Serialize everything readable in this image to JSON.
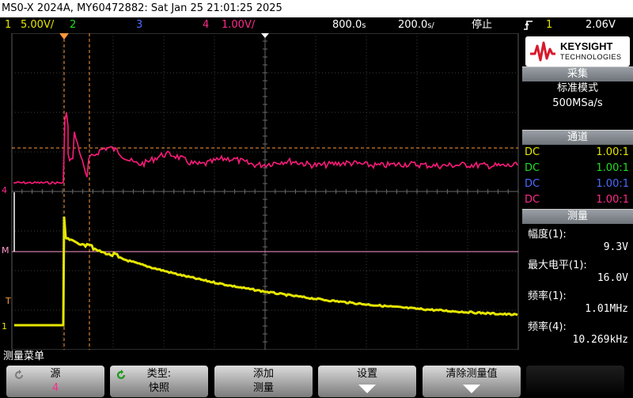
{
  "title": "MS0-X 2024A, MY60472882: Sat Jan 25 21:01:25 2025",
  "status": {
    "ch1_num": "1",
    "ch1_scale": "5.00V/",
    "ch2_num": "2",
    "ch3_num": "3",
    "ch4_num": "4",
    "ch4_scale": "1.00V/",
    "delay": "800.0",
    "timebase": "200.0",
    "unit_suffix": "s/",
    "delay_suffix": "s",
    "run_state": "停止",
    "trigger_source": "1",
    "trigger_level": "2.06V"
  },
  "logo": {
    "brand": "KEYSIGHT",
    "sub": "TECHNOLOGIES"
  },
  "acquisition": {
    "header": "采集",
    "mode": "标准模式",
    "rate": "500MSa/s"
  },
  "channels": {
    "header": "通道",
    "rows": [
      {
        "coupling": "DC",
        "value": "1.00:1",
        "color": "#e6e600"
      },
      {
        "coupling": "DC",
        "value": "1.00:1",
        "color": "#22dd22"
      },
      {
        "coupling": "DC",
        "value": "1.00:1",
        "color": "#4a6cff"
      },
      {
        "coupling": "DC",
        "value": "1.00:1",
        "color": "#ff2a8a"
      }
    ]
  },
  "measurements": {
    "header": "测量",
    "items": [
      {
        "label": "幅度(1):",
        "value": "9.3V"
      },
      {
        "label": "最大电平(1):",
        "value": "16.0V"
      },
      {
        "label": "频率(1):",
        "value": "1.01MHz"
      },
      {
        "label": "频率(4):",
        "value": "10.269kHz"
      }
    ]
  },
  "markers": {
    "ch4": "4",
    "math": "M",
    "trig": "T",
    "ch1": "1"
  },
  "menu": {
    "title": "测量菜单"
  },
  "softkeys": [
    {
      "line1": "源",
      "line2": "4"
    },
    {
      "line1": "类型:",
      "line2": "快照"
    },
    {
      "line1": "添加",
      "line2": "测量"
    },
    {
      "line1": "设置",
      "line2": ""
    },
    {
      "line1": "清除测量值",
      "line2": ""
    }
  ],
  "colors": {
    "ch1": "#e6e600",
    "ch2": "#22dd22",
    "ch3": "#4a6cff",
    "ch4": "#ff2a8a",
    "accent": "#ff9a3c"
  }
}
